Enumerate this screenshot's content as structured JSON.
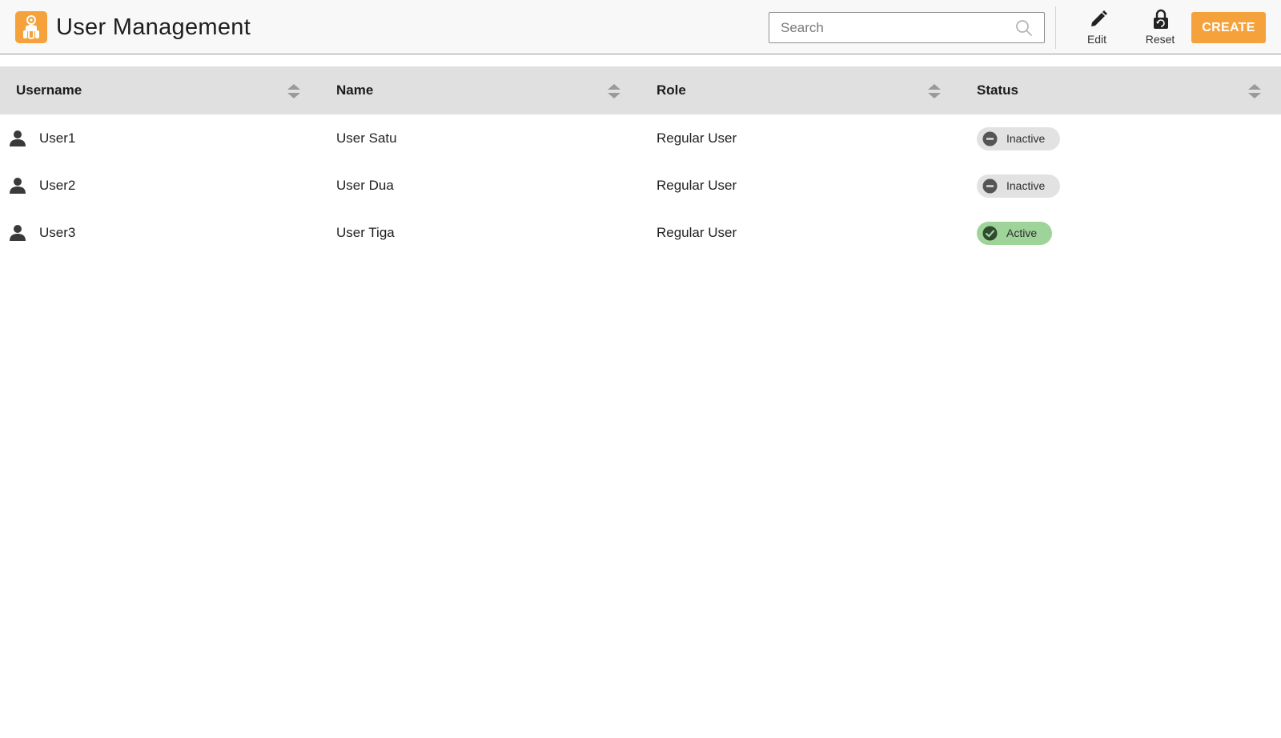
{
  "header": {
    "title": "User Management",
    "search_placeholder": "Search",
    "edit_label": "Edit",
    "reset_label": "Reset",
    "create_label": "CREATE"
  },
  "table": {
    "columns": [
      "Username",
      "Name",
      "Role",
      "Status"
    ],
    "rows": [
      {
        "username": "User1",
        "name": "User Satu",
        "role": "Regular User",
        "status": "Inactive"
      },
      {
        "username": "User2",
        "name": "User Dua",
        "role": "Regular User",
        "status": "Inactive"
      },
      {
        "username": "User3",
        "name": "User Tiga",
        "role": "Regular User",
        "status": "Active"
      }
    ]
  },
  "icons": {
    "logo": "app-logo-icon",
    "search": "search-icon",
    "edit": "pencil-icon",
    "reset": "lock-icon",
    "sort": "sort-icon",
    "user": "user-icon",
    "inactive": "minus-circle-icon",
    "active": "check-circle-icon"
  },
  "colors": {
    "accent": "#f6a23c",
    "header_bg": "#f8f8f8",
    "table_header_bg": "#e0e0e0",
    "inactive_badge": "#e2e2e2",
    "active_badge": "#9ed39a"
  }
}
